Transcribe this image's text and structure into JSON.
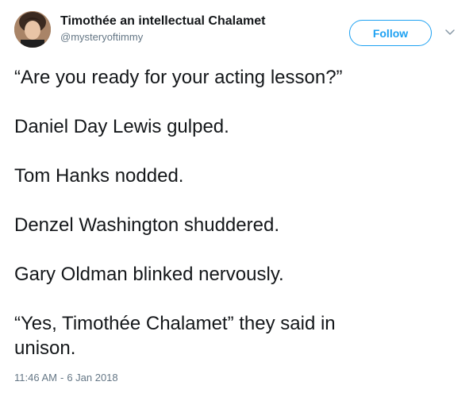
{
  "user": {
    "display_name": "Timothée an intellectual Chalamet",
    "handle": "@mysteryoftimmy"
  },
  "actions": {
    "follow_label": "Follow"
  },
  "tweet": {
    "lines": [
      "“Are you ready for your acting lesson?”",
      "Daniel Day Lewis gulped.",
      "Tom Hanks nodded.",
      "Denzel Washington shuddered.",
      "Gary Oldman blinked nervously.",
      "“Yes, Timothée Chalamet” they said in unison."
    ]
  },
  "meta": {
    "time": "11:46 AM",
    "separator": "-",
    "date": "6 Jan 2018"
  },
  "colors": {
    "accent": "#1da1f2",
    "text": "#14171a",
    "secondary": "#657786"
  },
  "icons": {
    "avatar": "profile-photo",
    "menu": "chevron-down-icon"
  }
}
